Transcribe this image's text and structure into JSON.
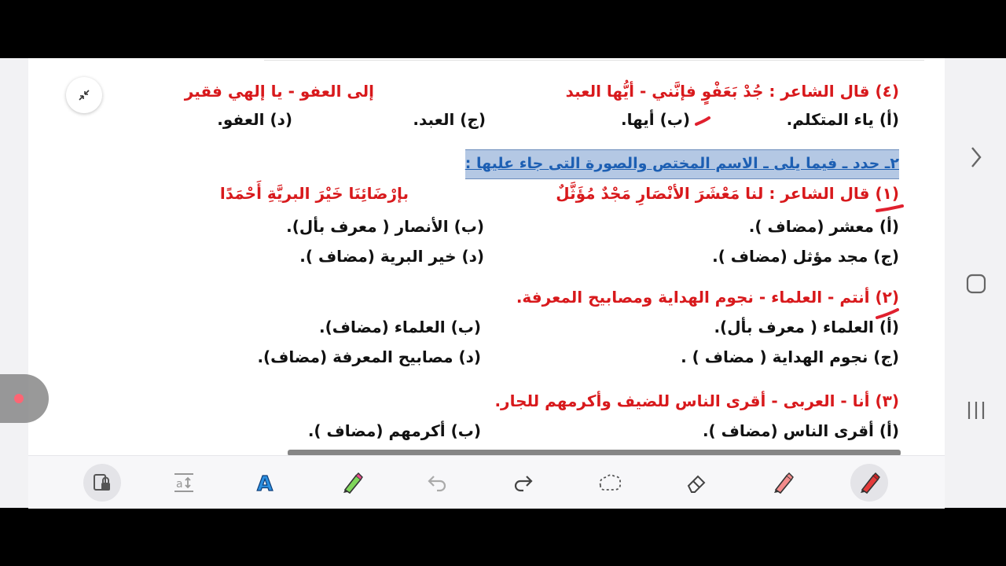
{
  "document": {
    "q4": {
      "line": "(٤) قال الشاعر : جُدْ بَعَفْوٍ فإنَّني - أيُّها العبد",
      "second_hemistich": "إلى العفو - يا إلهي فقير",
      "options": [
        "(أ) ياء المتكلم.",
        "(ب) أيها.",
        "(ج) العبد.",
        "(د) العفو."
      ]
    },
    "section2_heading": "٢ـ حدد ـ فيما يلى ـ الاسم المختص والصورة التى جاء عليها :",
    "q1": {
      "line": "(١) قال الشاعر : لنا مَعْشَرَ الأنْصَارِ مَجْدٌ مُؤَثَّلٌ",
      "second_hemistich": "بإرْضَائِنَا خَيْرَ البريَّةِ أَحْمَدًا",
      "options": [
        "(أ) معشر (مضاف ).",
        "(ب) الأنصار ( معرف بأل).",
        "(ج) مجد مؤثل (مضاف ).",
        "(د) خير البرية (مضاف )."
      ]
    },
    "q2": {
      "line": "(٢) أنتم - العلماء - نجوم الهداية ومصابيح المعرفة.",
      "options": [
        "(أ) العلماء ( معرف بأل).",
        "(ب) العلماء (مضاف).",
        "(ج) نجوم الهداية ( مضاف ) .",
        "(د) مصابيح المعرفة (مضاف)."
      ]
    },
    "q3": {
      "line": "(٣) أنا - العربى - أقرى الناس للضيف وأكرمهم للجار.",
      "options": [
        "(أ) أقرى الناس (مضاف ).",
        "(ب) أكرمهم (مضاف )."
      ]
    }
  },
  "toolbar": {
    "tools": [
      "lock-icon",
      "text-size-icon",
      "text-style-icon",
      "highlighter-icon",
      "undo-icon",
      "redo-icon",
      "lasso-icon",
      "eraser-icon",
      "marker-icon",
      "pen-icon"
    ],
    "active_tool": "pen-icon"
  },
  "colors": {
    "red_text": "#d8191c",
    "heading_blue": "#1d5fb3",
    "heading_bg": "#b4c8e4"
  }
}
